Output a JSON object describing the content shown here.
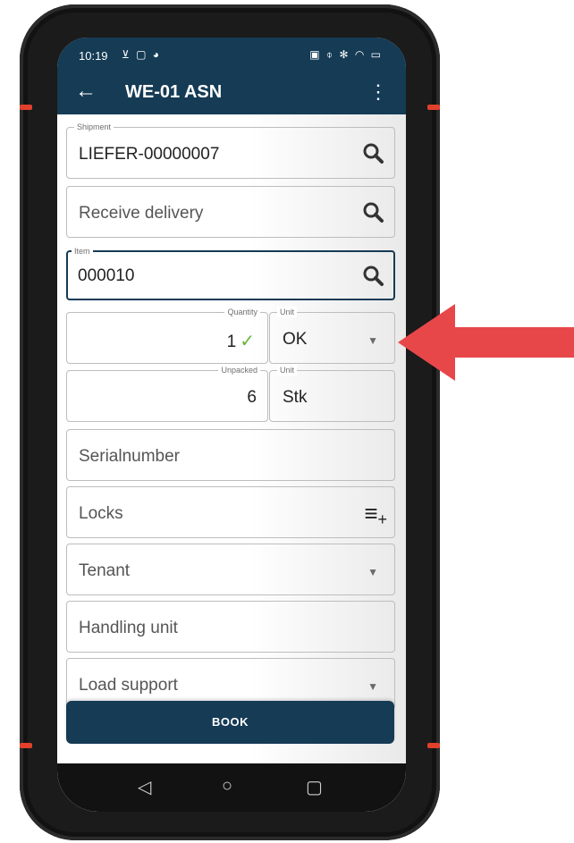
{
  "status": {
    "time": "10:19",
    "left_icons": "⊻ ▢ ◕",
    "right_icons": "▣ ⌽ ✻ ◠ ▭"
  },
  "appbar": {
    "title": "WE-01 ASN"
  },
  "fields": {
    "shipment": {
      "label": "Shipment",
      "value": "LIEFER-00000007"
    },
    "receive_delivery": {
      "placeholder": "Receive delivery"
    },
    "item": {
      "label": "Item",
      "value": "000010"
    },
    "quantity": {
      "label": "Quantity",
      "value": "1"
    },
    "quantity_unit": {
      "label": "Unit",
      "value": "OK"
    },
    "unpacked": {
      "label": "Unpacked",
      "value": "6"
    },
    "unpacked_unit": {
      "label": "Unit",
      "value": "Stk"
    },
    "serialnumber": {
      "placeholder": "Serialnumber"
    },
    "locks": {
      "placeholder": "Locks"
    },
    "tenant": {
      "placeholder": "Tenant"
    },
    "handling_unit": {
      "placeholder": "Handling unit"
    },
    "load_support": {
      "placeholder": "Load support"
    }
  },
  "book_button": {
    "label": "BOOK"
  },
  "colors": {
    "primary": "#153b55",
    "accent_arrow": "#e8474a",
    "check": "#6ab33a"
  }
}
